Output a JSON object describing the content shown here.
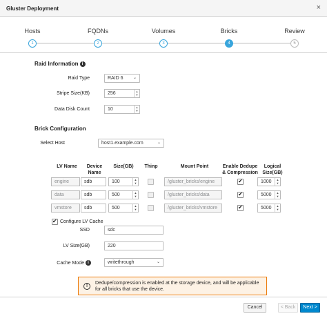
{
  "window": {
    "title": "Gluster Deployment",
    "close": "×"
  },
  "wizard": {
    "steps": [
      {
        "label": "Hosts",
        "num": "1"
      },
      {
        "label": "FQDNs",
        "num": "2"
      },
      {
        "label": "Volumes",
        "num": "3"
      },
      {
        "label": "Bricks",
        "num": "4"
      },
      {
        "label": "Review",
        "num": "5"
      }
    ],
    "active_step": "Bricks"
  },
  "raid": {
    "heading": "Raid Information",
    "raid_type_label": "Raid Type",
    "raid_type_value": "RAID 6",
    "stripe_label": "Stripe Size(KB)",
    "stripe_value": "256",
    "disk_count_label": "Data Disk Count",
    "disk_count_value": "10"
  },
  "brick": {
    "heading": "Brick Configuration",
    "select_host_label": "Select Host",
    "select_host_value": "host1.example.com"
  },
  "table": {
    "headers": {
      "lv_name": "LV Name",
      "device_name": "Device Name",
      "size": "Size(GB)",
      "thinp": "Thinp",
      "mount_point": "Mount Point",
      "dedupe": "Enable Dedupe & Compression",
      "logical_size": "Logical Size(GB)"
    },
    "rows": [
      {
        "lv_name": "engine",
        "device": "sdb",
        "size": "100",
        "thinp": false,
        "mount": "/gluster_bricks/engine",
        "dedupe": true,
        "logical": "1000"
      },
      {
        "lv_name": "data",
        "device": "sdb",
        "size": "500",
        "thinp": false,
        "mount": "/gluster_bricks/data",
        "dedupe": true,
        "logical": "5000"
      },
      {
        "lv_name": "vmstore",
        "device": "sdb",
        "size": "500",
        "thinp": false,
        "mount": "/gluster_bricks/vmstore",
        "dedupe": true,
        "logical": "5000"
      }
    ]
  },
  "cache": {
    "configure_label": "Configure LV Cache",
    "configure_checked": true,
    "ssd_label": "SSD",
    "ssd_value": "sdc",
    "lv_size_label": "LV Size(GB)",
    "lv_size_value": "220",
    "mode_label": "Cache Mode",
    "mode_value": "writethrough"
  },
  "alert": {
    "icon": "!",
    "message": "Dedupe/compression is enabled at the storage device, and will be applicable for all bricks that use the device."
  },
  "footer": {
    "cancel": "Cancel",
    "back": "< Back",
    "next": "Next >"
  },
  "colors": {
    "accent": "#39a5dc",
    "primary_button": "#0088ce",
    "warning_border": "#ec7a08",
    "warning_bg": "#fdf2e5"
  }
}
